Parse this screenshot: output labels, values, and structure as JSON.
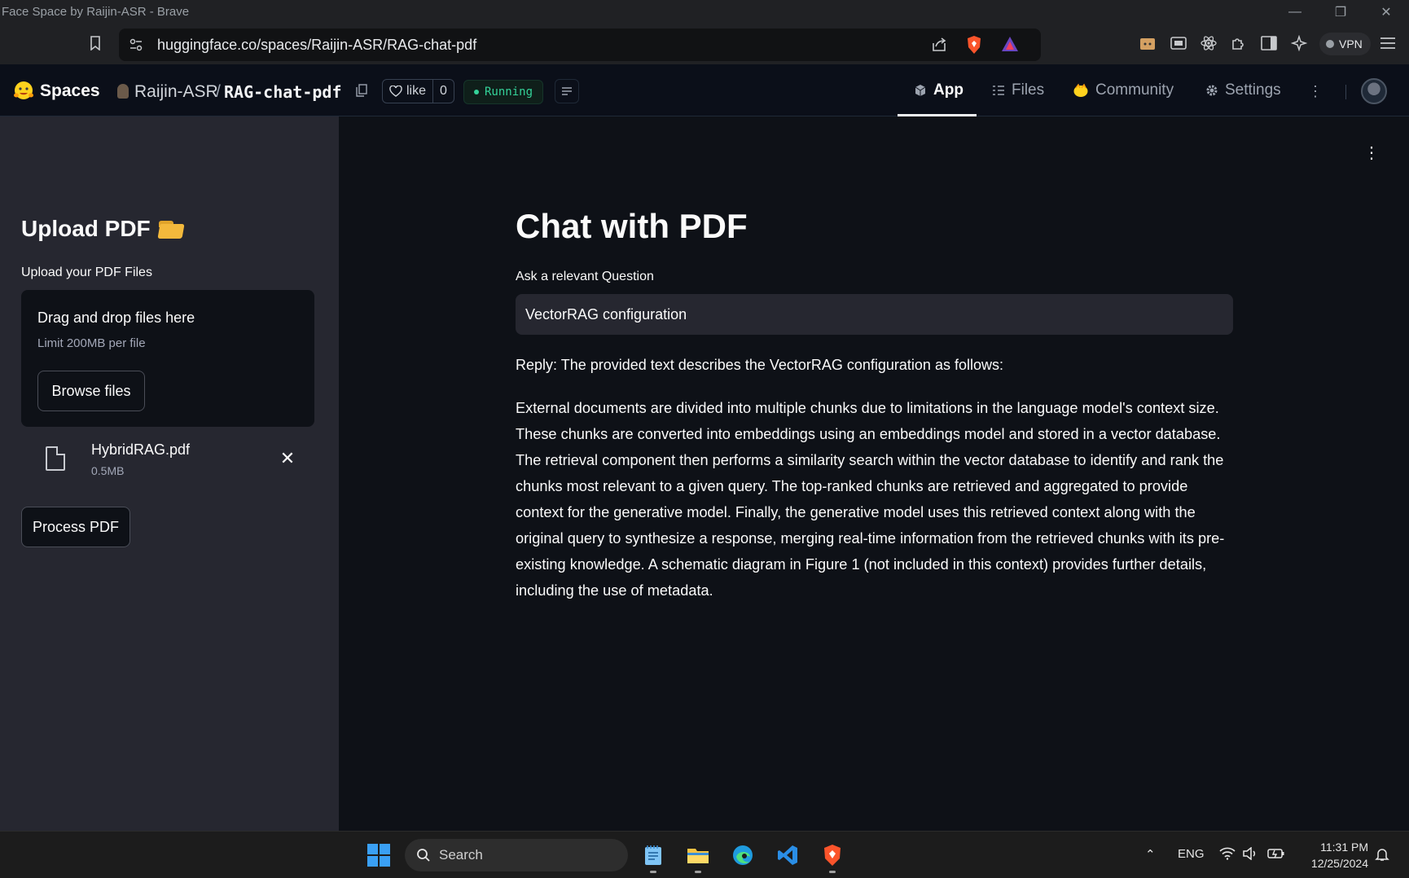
{
  "window": {
    "title": "Face Space by Raijin-ASR - Brave"
  },
  "browser": {
    "url": "huggingface.co/spaces/Raijin-ASR/RAG-chat-pdf",
    "vpn_label": "VPN"
  },
  "hf_header": {
    "spaces_label": "Spaces",
    "owner": "Raijin-ASR",
    "slash": "/",
    "repo": "RAG-chat-pdf",
    "like_label": "like",
    "like_count": "0",
    "status": "Running",
    "tabs": [
      {
        "label": "App",
        "icon": "cube-icon",
        "active": true
      },
      {
        "label": "Files",
        "icon": "files-icon",
        "active": false
      },
      {
        "label": "Community",
        "icon": "community-icon",
        "active": false
      },
      {
        "label": "Settings",
        "icon": "gear-icon",
        "active": false
      }
    ]
  },
  "sidebar": {
    "title": "Upload PDF",
    "upload_label": "Upload your PDF Files",
    "dropzone_main": "Drag and drop files here",
    "dropzone_limit": "Limit 200MB per file",
    "browse_label": "Browse files",
    "file": {
      "name": "HybridRAG.pdf",
      "size": "0.5MB"
    },
    "process_label": "Process PDF"
  },
  "main": {
    "title": "Chat with PDF",
    "question_label": "Ask a relevant Question",
    "question_value": "VectorRAG configuration",
    "reply_intro": "Reply: The provided text describes the VectorRAG configuration as follows:",
    "reply_body": "External documents are divided into multiple chunks due to limitations in the language model's context size. These chunks are converted into embeddings using an embeddings model and stored in a vector database. The retrieval component then performs a similarity search within the vector database to identify and rank the chunks most relevant to a given query. The top-ranked chunks are retrieved and aggregated to provide context for the generative model. Finally, the generative model uses this retrieved context along with the original query to synthesize a response, merging real-time information from the retrieved chunks with its pre-existing knowledge. A schematic diagram in Figure 1 (not included in this context) provides further details, including the use of metadata."
  },
  "taskbar": {
    "search_label": "Search",
    "language": "ENG",
    "time": "11:31 PM",
    "date": "12/25/2024"
  },
  "colors": {
    "accent_running": "#34d399",
    "sidebar_bg": "#262730",
    "main_bg": "#0e1117"
  }
}
